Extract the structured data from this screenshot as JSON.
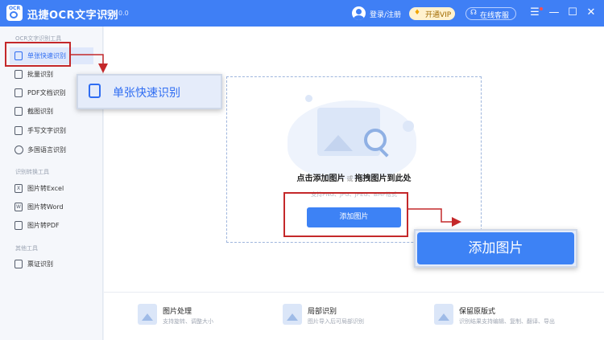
{
  "titlebar": {
    "logo_text": "OCR",
    "app_title": "迅捷OCR文字识别",
    "version": "v8.6.0.0",
    "login_label": "登录/注册",
    "vip_label": "开通VIP",
    "service_label": "在线客服",
    "icons": [
      "app-logo",
      "user-avatar",
      "diamond-icon",
      "headset-icon",
      "menu-icon",
      "minimize-icon",
      "maximize-icon",
      "close-icon"
    ]
  },
  "sidebar": {
    "sections": [
      {
        "title": "OCR文字识别工具",
        "items": [
          {
            "label": "单张快速识别",
            "icon": "single-scan-icon",
            "active": true
          },
          {
            "label": "批量识别",
            "icon": "batch-icon"
          },
          {
            "label": "PDF文档识别",
            "icon": "pdf-doc-icon"
          },
          {
            "label": "截图识别",
            "icon": "crop-icon"
          },
          {
            "label": "手写文字识别",
            "icon": "handwriting-icon"
          },
          {
            "label": "多国语言识别",
            "icon": "globe-icon"
          }
        ]
      },
      {
        "title": "识别转换工具",
        "items": [
          {
            "label": "图片转Excel",
            "icon": "excel-icon"
          },
          {
            "label": "图片转Word",
            "icon": "word-icon"
          },
          {
            "label": "图片转PDF",
            "icon": "pdf-icon"
          }
        ]
      },
      {
        "title": "其他工具",
        "items": [
          {
            "label": "票证识别",
            "icon": "ticket-icon"
          }
        ]
      }
    ]
  },
  "main": {
    "drop_title_part1": "点击添加图片",
    "drop_or": "或",
    "drop_title_part2": "拖拽图片到此处",
    "drop_hint": "支持PNG、JPG、JPEG、BMP格式",
    "add_button": "添加图片"
  },
  "callouts": {
    "single_label": "单张快速识别",
    "add_label": "添加图片",
    "highlight_color": "#c4282a"
  },
  "footer": {
    "features": [
      {
        "title": "图片处理",
        "desc": "支持旋转、调整大小"
      },
      {
        "title": "局部识别",
        "desc": "图片导入后可局部识别"
      },
      {
        "title": "保留原版式",
        "desc": "识别结果支持编辑、复制、翻译、导出"
      }
    ]
  },
  "colors": {
    "accent": "#3f7ff5",
    "button": "#3d82f5",
    "active_bg": "#dfe8fb"
  }
}
